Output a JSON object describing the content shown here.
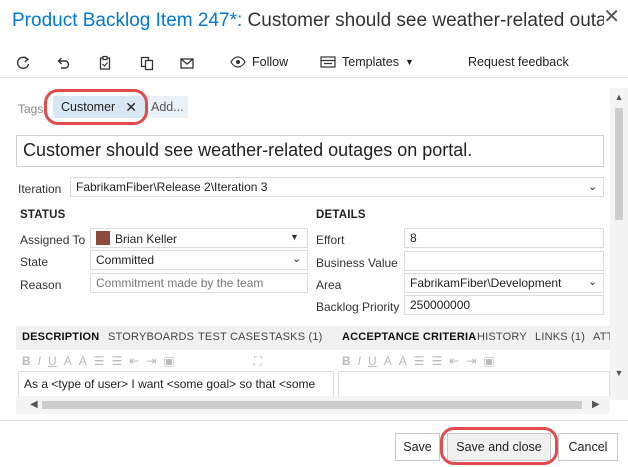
{
  "window": {
    "work_item_type": "Product Backlog Item 247*:",
    "title_text": " Customer should see weather-related outages on portal."
  },
  "toolbar": {
    "follow_label": "Follow",
    "templates_label": "Templates",
    "request_feedback_label": "Request feedback"
  },
  "tags": {
    "label": "Tags",
    "items": [
      "Customer"
    ],
    "add_label": "Add..."
  },
  "work_item_title": "Customer should see weather-related outages on portal.",
  "iteration": {
    "label": "Iteration",
    "value": "FabrikamFiber\\Release 2\\Iteration 3"
  },
  "status": {
    "heading": "STATUS",
    "assigned_to_label": "Assigned To",
    "assigned_to_value": "Brian Keller",
    "state_label": "State",
    "state_value": "Committed",
    "reason_label": "Reason",
    "reason_placeholder": "Commitment made by the team"
  },
  "details": {
    "heading": "DETAILS",
    "effort_label": "Effort",
    "effort_value": "8",
    "business_value_label": "Business Value",
    "business_value_value": "",
    "area_label": "Area",
    "area_value": "FabrikamFiber\\Development",
    "backlog_priority_label": "Backlog Priority",
    "backlog_priority_value": "250000000"
  },
  "left_tabs": [
    "DESCRIPTION",
    "STORYBOARDS",
    "TEST CASES",
    "TASKS (1)"
  ],
  "right_tabs": [
    "ACCEPTANCE CRITERIA",
    "HISTORY",
    "LINKS (1)",
    "ATT"
  ],
  "description_text": "As a <type of user> I want <some goal> so that <some",
  "footer": {
    "save_label": "Save",
    "save_and_close_label": "Save and close",
    "cancel_label": "Cancel"
  },
  "colors": {
    "accent": "#0078d7",
    "tag_bg": "#d7e7f3",
    "highlight": "#e14b4b"
  }
}
